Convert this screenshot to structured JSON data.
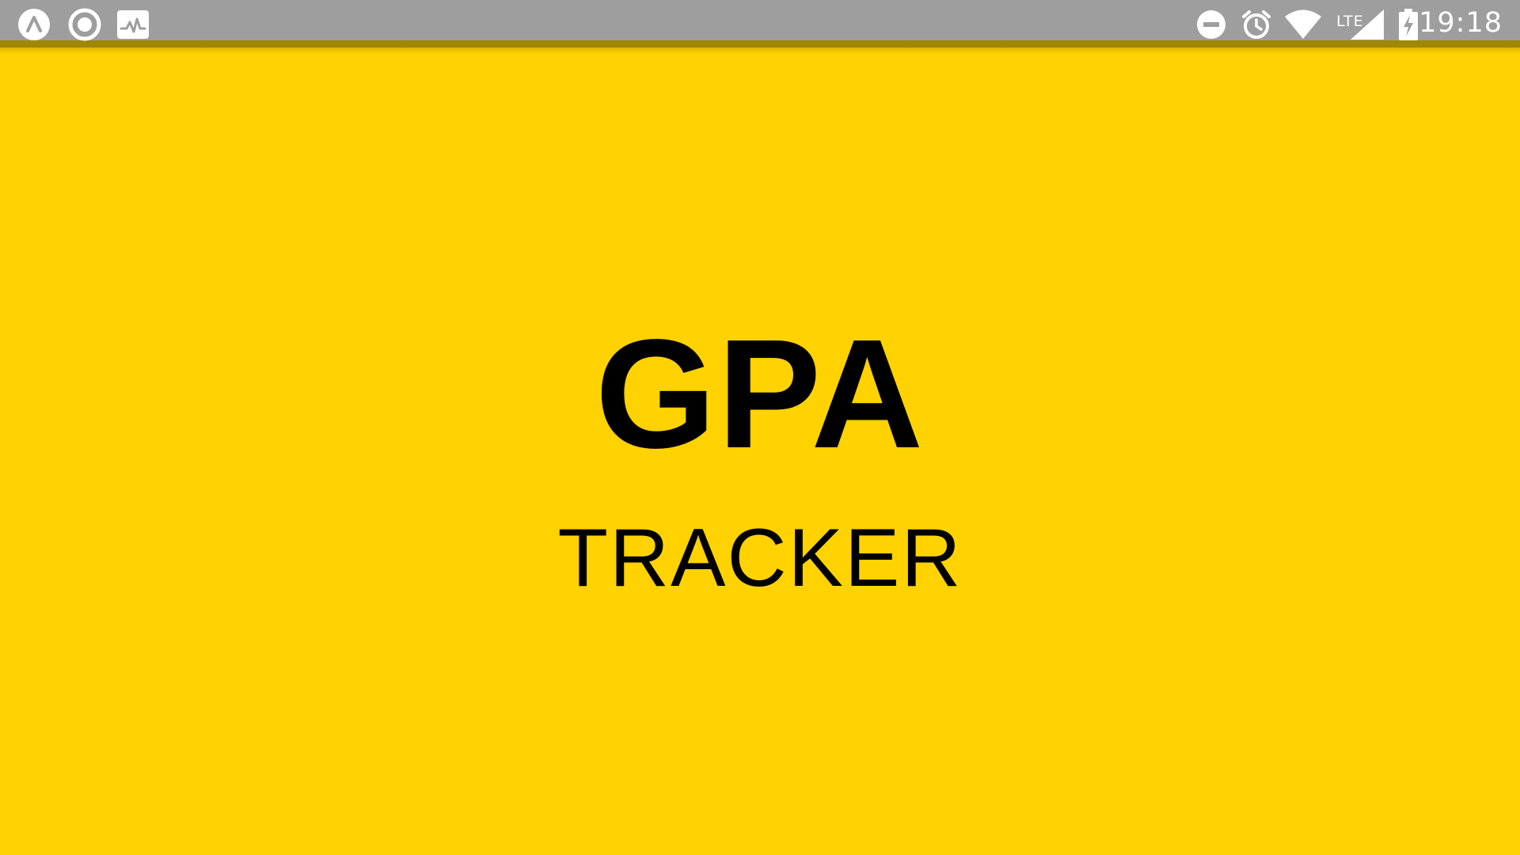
{
  "status_bar": {
    "time": "19:18",
    "network_type": "LTE",
    "left_icons": [
      "expo-icon",
      "record-icon",
      "activity-monitor-icon"
    ],
    "right_icons": [
      "do-not-disturb-icon",
      "alarm-icon",
      "wifi-icon",
      "cell-signal-icon",
      "battery-charging-icon"
    ],
    "background_color": "#9E9E9E"
  },
  "app": {
    "title": "GPA",
    "subtitle": "TRACKER",
    "background_color": "#FFD200",
    "text_color": "#000000"
  }
}
